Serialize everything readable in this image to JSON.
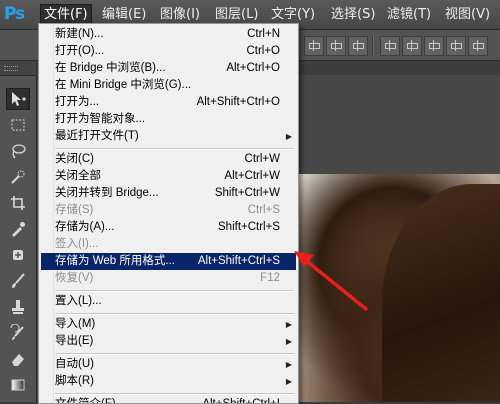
{
  "app": {
    "logo": "Ps"
  },
  "menubar": [
    {
      "label": "文件(F)",
      "active": true
    },
    {
      "label": "编辑(E)"
    },
    {
      "label": "图像(I)"
    },
    {
      "label": "图层(L)"
    },
    {
      "label": "文字(Y)"
    },
    {
      "label": "选择(S)"
    },
    {
      "label": "滤镜(T)"
    },
    {
      "label": "视图(V)"
    }
  ],
  "file_menu": {
    "items": [
      {
        "label": "新建(N)...",
        "shortcut": "Ctrl+N"
      },
      {
        "label": "打开(O)...",
        "shortcut": "Ctrl+O"
      },
      {
        "label": "在 Bridge 中浏览(B)...",
        "shortcut": "Alt+Ctrl+O"
      },
      {
        "label": "在 Mini Bridge 中浏览(G)...",
        "shortcut": ""
      },
      {
        "label": "打开为...",
        "shortcut": "Alt+Shift+Ctrl+O"
      },
      {
        "label": "打开为智能对象...",
        "shortcut": ""
      },
      {
        "label": "最近打开文件(T)",
        "shortcut": "",
        "submenu": true
      },
      {
        "label": "关闭(C)",
        "shortcut": "Ctrl+W"
      },
      {
        "label": "关闭全部",
        "shortcut": "Alt+Ctrl+W"
      },
      {
        "label": "关闭并转到 Bridge...",
        "shortcut": "Shift+Ctrl+W"
      },
      {
        "label": "存储(S)",
        "shortcut": "Ctrl+S",
        "disabled": true
      },
      {
        "label": "存储为(A)...",
        "shortcut": "Shift+Ctrl+S"
      },
      {
        "label": "签入(I)...",
        "shortcut": "",
        "disabled": true
      },
      {
        "label": "存储为 Web 所用格式...",
        "shortcut": "Alt+Shift+Ctrl+S",
        "highlighted": true
      },
      {
        "label": "恢复(V)",
        "shortcut": "F12",
        "disabled": true
      },
      {
        "label": "置入(L)...",
        "shortcut": ""
      },
      {
        "label": "导入(M)",
        "shortcut": "",
        "submenu": true
      },
      {
        "label": "导出(E)",
        "shortcut": "",
        "submenu": true
      },
      {
        "label": "自动(U)",
        "shortcut": "",
        "submenu": true
      },
      {
        "label": "脚本(R)",
        "shortcut": "",
        "submenu": true
      },
      {
        "label": "文件简介(F)...",
        "shortcut": "Alt+Shift+Ctrl+I"
      }
    ]
  },
  "icons": {
    "submenu_arrow": "▶"
  },
  "colors": {
    "highlight": "#0a246a",
    "annotation": "#e8201a",
    "logo": "#2aa0e8"
  }
}
